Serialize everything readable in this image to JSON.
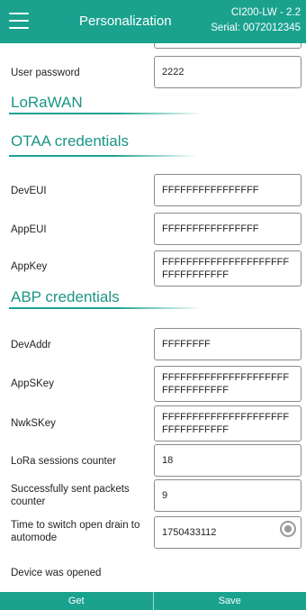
{
  "header": {
    "title": "Personalization",
    "device": "CI200-LW - 2.2",
    "serial": "Serial: 0072012345"
  },
  "fields": {
    "user_password": {
      "label": "User password",
      "value": "2222"
    },
    "dev_eui": {
      "label": "DevEUI",
      "value": "FFFFFFFFFFFFFFFF"
    },
    "app_eui": {
      "label": "AppEUI",
      "value": "FFFFFFFFFFFFFFFF"
    },
    "app_key": {
      "label": "AppKey",
      "value": "FFFFFFFFFFFFFFFFFFFFFFFFFFFFFFFF"
    },
    "dev_addr": {
      "label": "DevAddr",
      "value": "FFFFFFFF"
    },
    "app_skey": {
      "label": "AppSKey",
      "value": "FFFFFFFFFFFFFFFFFFFFFFFFFFFFFFFF"
    },
    "nwk_skey": {
      "label": "NwkSKey",
      "value": "FFFFFFFFFFFFFFFFFFFFFFFFFFFFFFFF"
    },
    "lora_sessions": {
      "label": "LoRa sessions counter",
      "value": "18"
    },
    "sent_packets": {
      "label": "Successfully sent packets counter",
      "value": "9"
    },
    "switch_time": {
      "label": "Time to switch open drain to automode",
      "value": "1750433112"
    },
    "device_opened": {
      "label": "Device was opened",
      "checked": true
    }
  },
  "sections": {
    "lorawan": "LoRaWAN",
    "otaa": "OTAA credentials",
    "abp": "ABP credentials"
  },
  "footer": {
    "get_label": "Get",
    "save_label": "Save"
  },
  "colors": {
    "accent": "#1aa28f",
    "section_text": "#1a9585"
  }
}
